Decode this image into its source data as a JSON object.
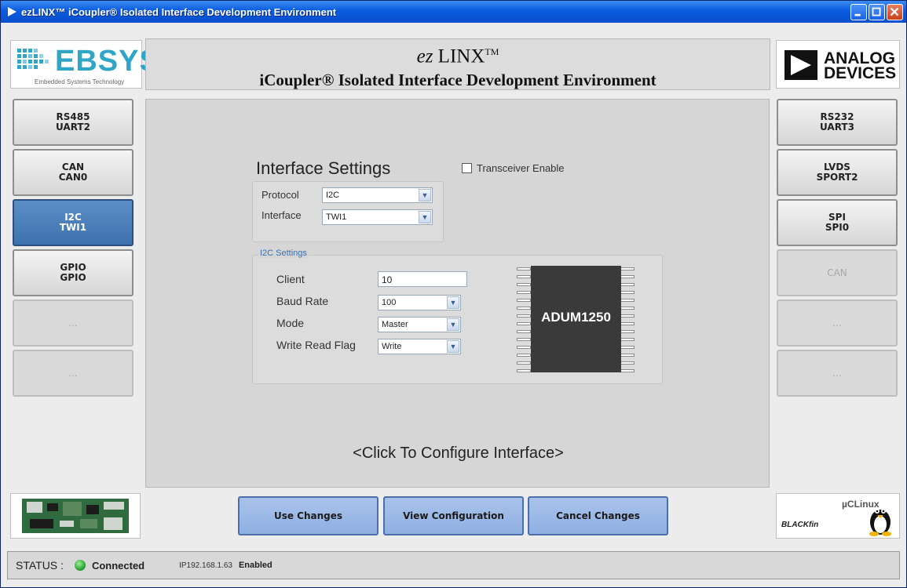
{
  "window": {
    "title": "ezLINX™ iCoupler® Isolated Interface Development Environment"
  },
  "header": {
    "title_prefix": "ez",
    "title_main": "LINX",
    "title_tm": "TM",
    "subtitle": "iCoupler® Isolated Interface Development Environment",
    "left_logo": "EBSYS",
    "left_logo_sub": "Embedded Systems Technology",
    "right_logo_line1": "ANALOG",
    "right_logo_line2": "DEVICES"
  },
  "left_buttons": [
    {
      "label": "RS485\nUART2",
      "state": "normal"
    },
    {
      "label": "CAN\nCAN0",
      "state": "normal"
    },
    {
      "label": "I2C\nTWI1",
      "state": "active"
    },
    {
      "label": "GPIO\nGPIO",
      "state": "normal"
    },
    {
      "label": "...",
      "state": "disabled"
    },
    {
      "label": "...",
      "state": "disabled"
    }
  ],
  "right_buttons": [
    {
      "label": "RS232\nUART3",
      "state": "normal"
    },
    {
      "label": "LVDS\nSPORT2",
      "state": "normal"
    },
    {
      "label": "SPI\nSPI0",
      "state": "normal"
    },
    {
      "label": "CAN",
      "state": "disabled"
    },
    {
      "label": "...",
      "state": "disabled"
    },
    {
      "label": "...",
      "state": "disabled"
    }
  ],
  "interface": {
    "title": "Interface Settings",
    "transceiver_label": "Transceiver Enable",
    "transceiver_checked": false,
    "protocol_label": "Protocol",
    "protocol_value": "I2C",
    "interface_label": "Interface",
    "interface_value": "TWI1"
  },
  "i2c": {
    "legend": "I2C Settings",
    "client_label": "Client",
    "client_value": "10",
    "baud_label": "Baud Rate",
    "baud_value": "100",
    "mode_label": "Mode",
    "mode_value": "Master",
    "flag_label": "Write Read Flag",
    "flag_value": "Write",
    "chip_label": "ADUM1250"
  },
  "main": {
    "configure_prompt": "<Click To Configure Interface>"
  },
  "bottom": {
    "use_changes": "Use Changes",
    "view_configuration": "View Configuration",
    "cancel_changes": "Cancel Changes",
    "uclinux": "µCLinux",
    "blackfin": "BLACKfin"
  },
  "status": {
    "label": "STATUS :",
    "connection": "Connected",
    "ip": "IP192.168.1.63",
    "enabled": "Enabled",
    "led_color": "#1e9a2a"
  }
}
